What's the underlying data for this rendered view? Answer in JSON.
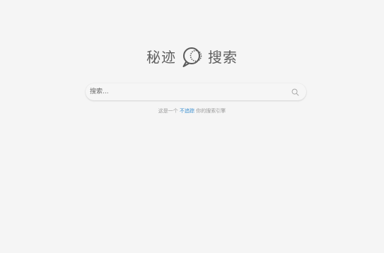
{
  "logo": {
    "left_text": "秘迹",
    "right_text": "搜索",
    "icon": "magnifier-bubble-icon"
  },
  "search": {
    "placeholder": "搜索...",
    "value": "",
    "button_icon": "search-icon"
  },
  "tagline": {
    "prefix": "这是一个",
    "link": "不追踪",
    "suffix": "你的搜索引擎"
  },
  "colors": {
    "background": "#f5f5f5",
    "logo_text": "#5e5e5e",
    "link": "#3a8fd0",
    "tagline": "#9a9a9a"
  }
}
